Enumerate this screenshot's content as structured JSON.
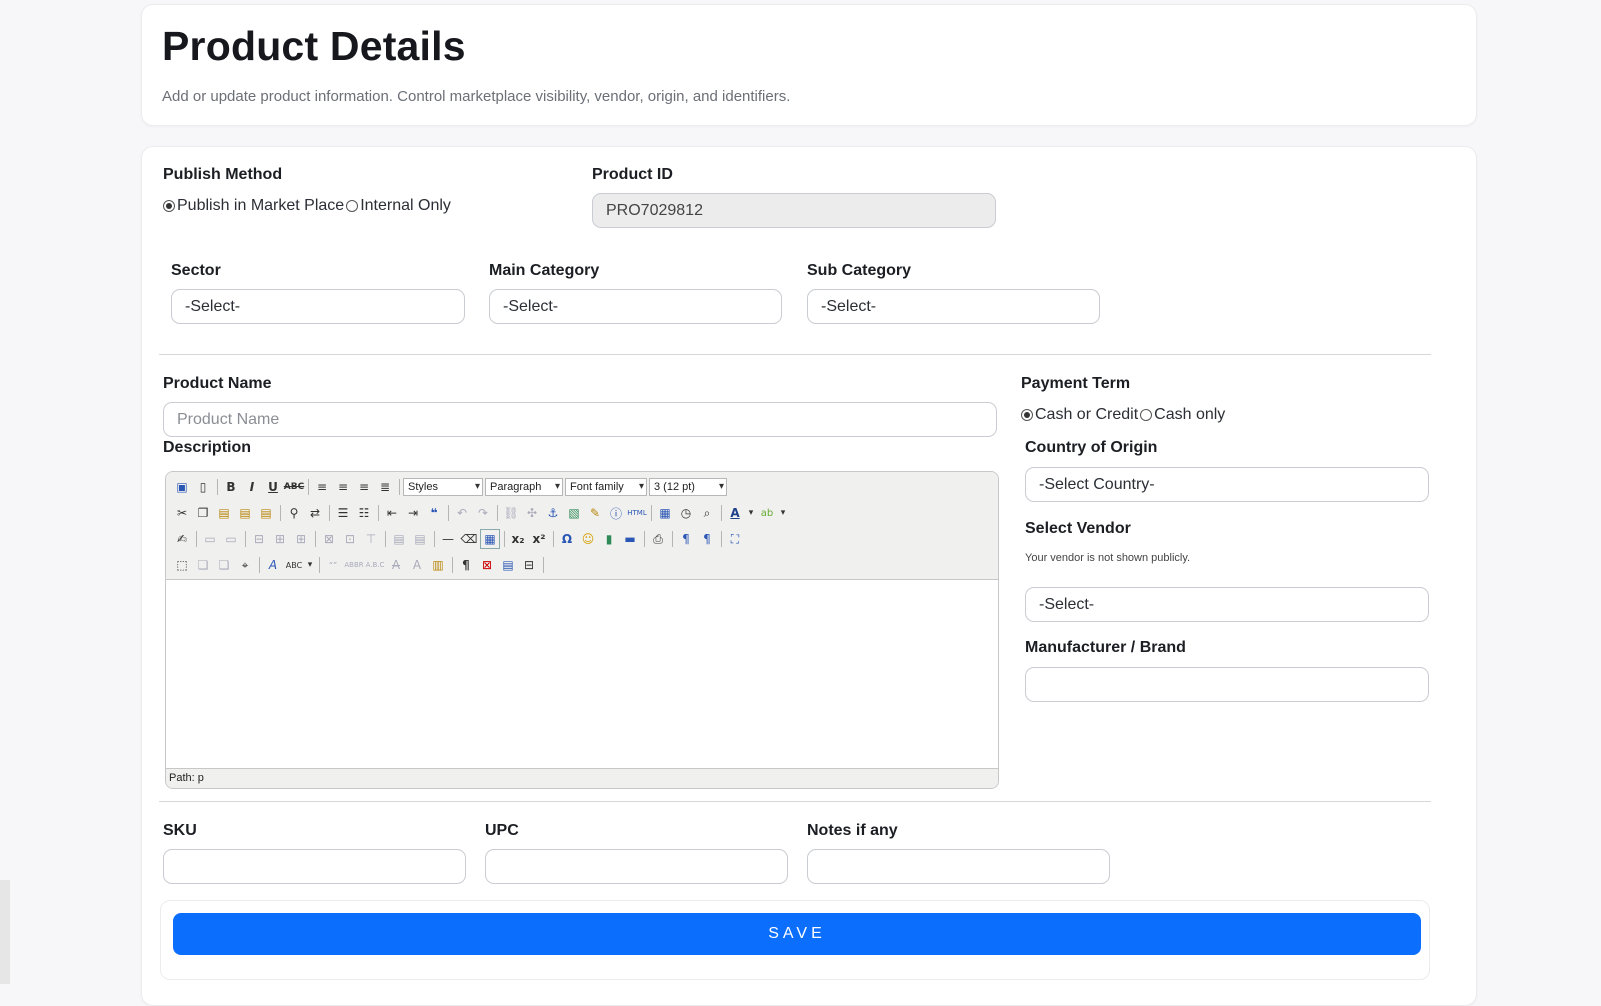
{
  "header": {
    "title": "Product Details",
    "subtitle": "Add or update product information. Control marketplace visibility, vendor, origin, and identifiers."
  },
  "publish_method": {
    "label": "Publish Method",
    "options": [
      "Publish in Market Place",
      "Internal Only"
    ],
    "selected": "Publish in Market Place"
  },
  "product_id": {
    "label": "Product ID",
    "value": "PRO7029812"
  },
  "sector": {
    "label": "Sector",
    "value": "-Select-"
  },
  "main_category": {
    "label": "Main Category",
    "value": "-Select-"
  },
  "sub_category": {
    "label": "Sub Category",
    "value": "-Select-"
  },
  "product_name": {
    "label": "Product Name",
    "placeholder": "Product Name",
    "value": ""
  },
  "description": {
    "label": "Description",
    "toolbar": {
      "styles": "Styles",
      "format": "Paragraph",
      "font_family": "Font family",
      "font_size": "3 (12 pt)"
    },
    "status_path": "Path: p"
  },
  "payment_term": {
    "label": "Payment Term",
    "options": [
      "Cash or Credit",
      "Cash only"
    ],
    "selected": "Cash or Credit"
  },
  "country_of_origin": {
    "label": "Country of Origin",
    "value": "-Select Country-"
  },
  "vendor": {
    "label": "Select Vendor",
    "hint": "Your vendor is not shown publicly.",
    "value": "-Select-"
  },
  "manufacturer": {
    "label": "Manufacturer / Brand",
    "value": ""
  },
  "sku": {
    "label": "SKU",
    "value": ""
  },
  "upc": {
    "label": "UPC",
    "value": ""
  },
  "notes": {
    "label": "Notes if any",
    "value": ""
  },
  "save_button": {
    "label": "SAVE"
  },
  "colors": {
    "primary": "#0b6efd",
    "text": "#1b1e23",
    "muted": "#6b6f76"
  }
}
